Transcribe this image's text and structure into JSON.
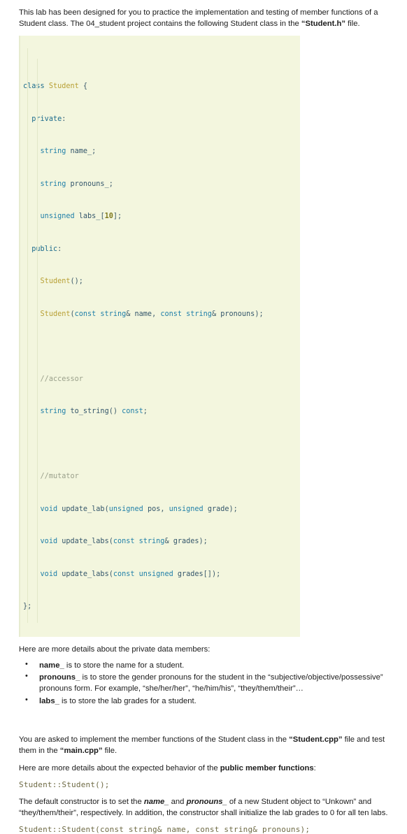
{
  "intro": {
    "paragraph": "This lab has been designed for you to practice the implementation and testing of member functions of a Student class. The 04_student project contains the following Student class in the ",
    "file_emphasis": "Student.h",
    "paragraph_tail": " file."
  },
  "code_block": {
    "language": "cpp",
    "lines": [
      "class Student {",
      "  private:",
      "    string name_;",
      "    string pronouns_;",
      "    unsigned labs_[10];",
      "  public:",
      "    Student();",
      "    Student(const string& name, const string& pronouns);",
      "",
      "    //accessor",
      "    string to_string() const;",
      "",
      "    //mutator",
      "    void update_lab(unsigned pos, unsigned grade);",
      "    void update_labs(const string& grades);",
      "    void update_labs(const unsigned grades[]);",
      "};"
    ],
    "background_color": "#f3f6de",
    "keyword_color": "#1f7fa8",
    "comment_color": "#9aa08b",
    "number_color": "#7f7a1e",
    "type_color": "#b8a035"
  },
  "private_members": {
    "lead_in": "Here are more details about the private data members:",
    "items": [
      {
        "name": "name_",
        "text": " is to store the name for a student."
      },
      {
        "name": "pronouns_",
        "text": " is to store the gender pronouns for the student in the “subjective/objective/possessive” pronouns form. For example, “she/her/her”, “he/him/his”, “they/them/their”…"
      },
      {
        "name": "labs_",
        "text": " is to store the lab grades for a student."
      }
    ]
  },
  "implementation": {
    "paragraph_a": "You are asked to implement the member functions of the Student class in the ",
    "file_cpp": "Student.cpp",
    "paragraph_b": " file and test them in the ",
    "file_main": "main.cpp",
    "paragraph_c": " file.",
    "lead_in_pre": "Here are more details about the expected behavior of the ",
    "lead_in_bold": "public member functions",
    "lead_in_post": ":"
  },
  "default_ctor": {
    "signature": "Student::Student();",
    "desc_a": "The default constructor is to set the ",
    "member_name": "name_",
    "desc_b": " and ",
    "member_pronouns": "pronouns_",
    "desc_c": " of a new Student object to “Unkown” and “they/them/their”, respectively. In addition, the constructor shall initialize the lab grades to 0 for all ten labs."
  },
  "param_ctor": {
    "signature": "Student::Student(const string& name, const string& pronouns);"
  }
}
